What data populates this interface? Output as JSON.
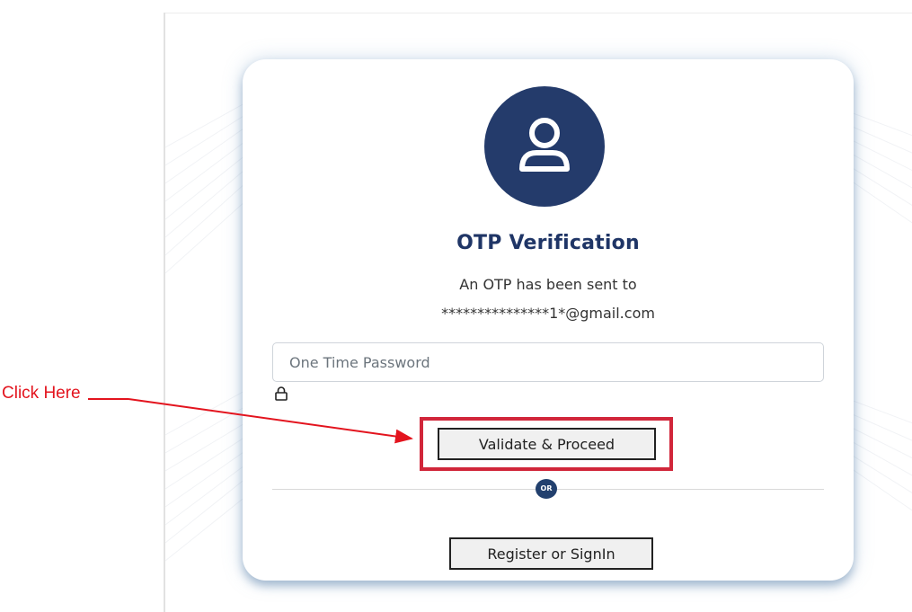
{
  "annotation": {
    "label": "Click Here",
    "color": "#e3141e"
  },
  "card": {
    "avatar_icon": "user-icon",
    "title": "OTP Verification",
    "message_line1": "An OTP has been sent to",
    "message_line2": "***************1*@gmail.com",
    "otp_field": {
      "value": "",
      "placeholder": "One Time Password"
    },
    "lock_icon": "lock-icon",
    "validate_button": "Validate & Proceed",
    "or_label": "OR",
    "register_button": "Register or SignIn"
  },
  "colors": {
    "brand_navy": "#243b6b",
    "highlight_red": "#d1263a",
    "text": "#333333"
  }
}
